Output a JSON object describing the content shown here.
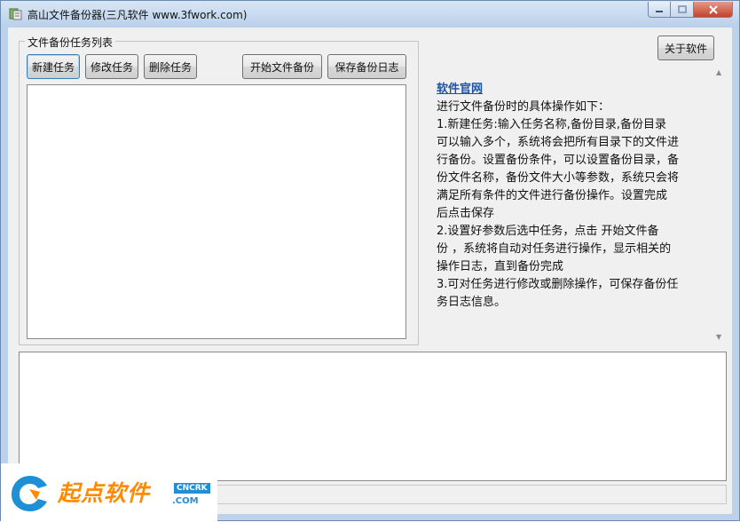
{
  "window": {
    "title": "高山文件备份器(三凡软件 www.3fwork.com)"
  },
  "task_group": {
    "legend": "文件备份任务列表",
    "buttons": {
      "new_task": "新建任务",
      "modify_task": "修改任务",
      "delete_task": "删除任务",
      "start_backup": "开始文件备份",
      "save_log": "保存备份日志"
    }
  },
  "about_button": "关于软件",
  "info": {
    "link": "软件官网",
    "lines": [
      "进行文件备份时的具体操作如下：",
      "1.新建任务:输入任务名称,备份目录,备份目录",
      "可以输入多个，系统将会把所有目录下的文件进",
      "行备份。设置备份条件，可以设置备份目录，备",
      "份文件名称，备份文件大小等参数，系统只会将",
      "满足所有条件的文件进行备份操作。设置完成",
      "后点击保存",
      "2.设置好参数后选中任务，点击 开始文件备",
      "份 ，系统将自动对任务进行操作，显示相关的",
      "操作日志，直到备份完成",
      "3.可对任务进行修改或删除操作，可保存备份任",
      "务日志信息。"
    ]
  },
  "watermark": {
    "text": "起点软件",
    "tag": "CNCRK",
    "domain": ".COM"
  },
  "colors": {
    "link": "#1c53a8",
    "watermark_orange": "#ff8a00",
    "watermark_blue": "#1f8fd6"
  }
}
